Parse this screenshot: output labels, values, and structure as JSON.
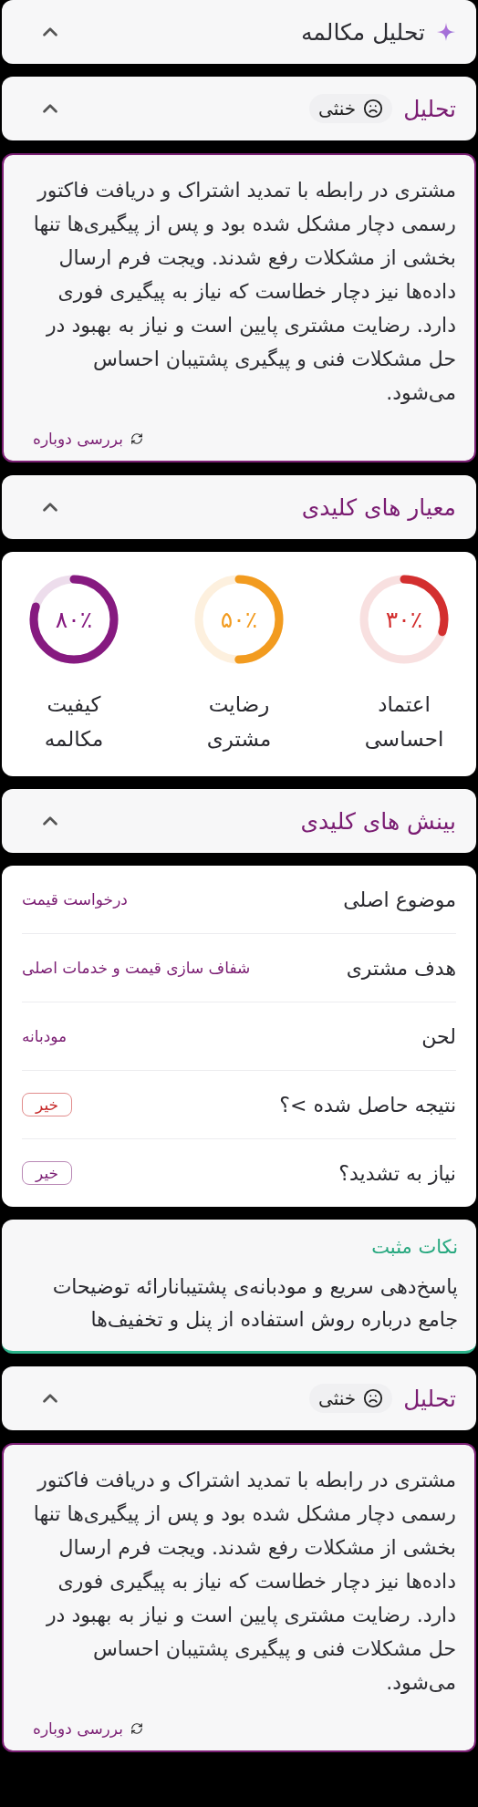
{
  "sections": [
    {
      "kind": "main_header",
      "title": "تحلیل مکالمه",
      "expanded": true
    },
    {
      "kind": "header",
      "title": "تحلیل",
      "badge": "خنثی",
      "expanded": true
    },
    {
      "kind": "summary",
      "text": "مشتری در رابطه با تمدید اشتراک و دریافت فاکتور رسمی دچار مشکل شده بود و پس از پیگیری‌ها تنها بخشی از مشکلات رفع شدند. ویجت فرم ارسال داده‌ها نیز دچار خطاست که نیاز به پیگیری فوری دارد. رضایت مشتری پایین است و نیاز به بهبود در حل مشکلات فنی و پیگیری پشتیبان احساس می‌شود.",
      "action": "بررسی دوباره"
    },
    {
      "kind": "header",
      "title": "معیار های کلیدی",
      "expanded": true
    },
    {
      "kind": "metrics",
      "items": [
        {
          "value": "۳۰٪",
          "label": "اعتماد احساسی",
          "level": 0.3,
          "color": "#d32f2f"
        },
        {
          "value": "۵۰٪",
          "label": "رضایت مشتری",
          "level": 0.5,
          "color": "#f29b1f"
        },
        {
          "value": "۸۰٪",
          "label": "کیفیت مکالمه",
          "level": 0.8,
          "color": "#861a80"
        }
      ]
    },
    {
      "kind": "header",
      "title": "بینش های کلیدی",
      "expanded": true
    },
    {
      "kind": "insights",
      "rows": [
        {
          "kind": "text",
          "label": "موضوع اصلی",
          "value": "درخواست قیمت"
        },
        {
          "kind": "text",
          "label": "هدف مشتری",
          "value": "شفاف سازی قیمت و خدمات اصلی"
        },
        {
          "kind": "text",
          "label": "لحن",
          "value": "مودبانه"
        },
        {
          "kind": "badge",
          "label": "نتیجه حاصل شده >؟",
          "value": "خیر",
          "color": "#c62828"
        },
        {
          "kind": "badge",
          "label": "نیاز به تشدید؟",
          "value": "خیر",
          "color": "#7b1f74"
        }
      ]
    },
    {
      "kind": "positives",
      "title": "نکات مثبت",
      "text": "پاسخ‌دهی سریع و مودبانه‌ی پشتیبانارائه توضیحات جامع درباره روش استفاده از پنل و تخفیف‌ها"
    },
    {
      "kind": "header",
      "title": "تحلیل",
      "badge": "خنثی",
      "expanded": true
    },
    {
      "kind": "summary",
      "text": "مشتری در رابطه با تمدید اشتراک و دریافت فاکتور رسمی دچار مشکل شده بود و پس از پیگیری‌ها تنها بخشی از مشکلات رفع شدند. ویجت فرم ارسال داده‌ها نیز دچار خطاست که نیاز به پیگیری فوری دارد. رضایت مشتری پایین است و نیاز به بهبود در حل مشکلات فنی و پیگیری پشتیبان احساس می‌شود.",
      "action": "بررسی دوباره"
    }
  ]
}
